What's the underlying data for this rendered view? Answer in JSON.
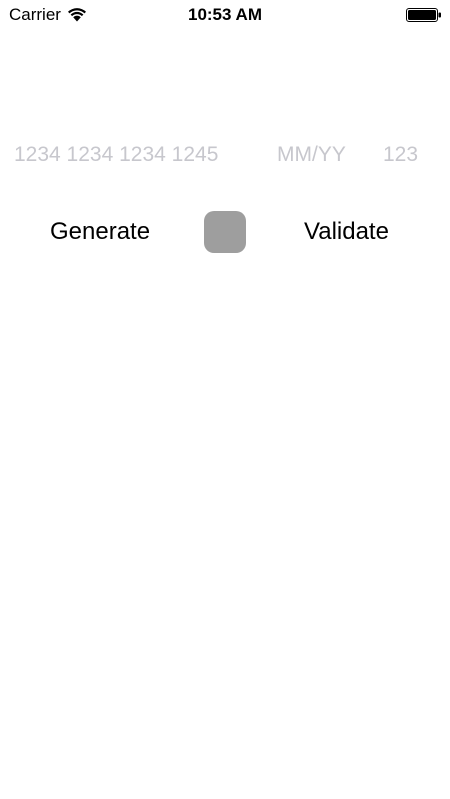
{
  "status_bar": {
    "carrier": "Carrier",
    "time": "10:53 AM",
    "wifi_icon": "wifi-icon",
    "battery_icon": "battery-icon",
    "battery_level": 1.0
  },
  "form": {
    "card_number": {
      "value": "",
      "placeholder": "1234 1234 1234 1245"
    },
    "expiry": {
      "value": "",
      "placeholder": "MM/YY"
    },
    "cvc": {
      "value": "",
      "placeholder": "123"
    }
  },
  "actions": {
    "generate_label": "Generate",
    "validate_label": "Validate",
    "status_indicator_color": "#9e9e9e"
  }
}
